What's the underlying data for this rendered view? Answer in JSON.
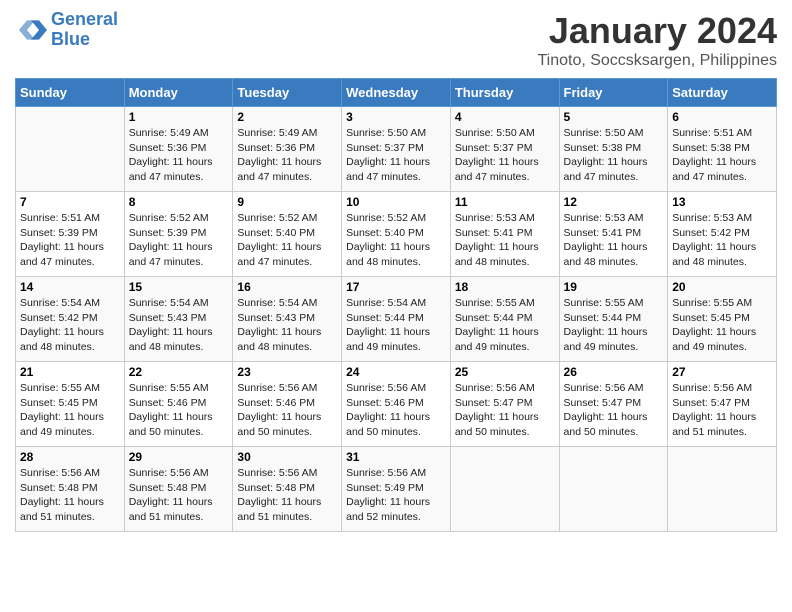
{
  "logo": {
    "line1": "General",
    "line2": "Blue"
  },
  "title": "January 2024",
  "location": "Tinoto, Soccsksargen, Philippines",
  "weekdays": [
    "Sunday",
    "Monday",
    "Tuesday",
    "Wednesday",
    "Thursday",
    "Friday",
    "Saturday"
  ],
  "weeks": [
    [
      {
        "day": "",
        "text": ""
      },
      {
        "day": "1",
        "text": "Sunrise: 5:49 AM\nSunset: 5:36 PM\nDaylight: 11 hours\nand 47 minutes."
      },
      {
        "day": "2",
        "text": "Sunrise: 5:49 AM\nSunset: 5:36 PM\nDaylight: 11 hours\nand 47 minutes."
      },
      {
        "day": "3",
        "text": "Sunrise: 5:50 AM\nSunset: 5:37 PM\nDaylight: 11 hours\nand 47 minutes."
      },
      {
        "day": "4",
        "text": "Sunrise: 5:50 AM\nSunset: 5:37 PM\nDaylight: 11 hours\nand 47 minutes."
      },
      {
        "day": "5",
        "text": "Sunrise: 5:50 AM\nSunset: 5:38 PM\nDaylight: 11 hours\nand 47 minutes."
      },
      {
        "day": "6",
        "text": "Sunrise: 5:51 AM\nSunset: 5:38 PM\nDaylight: 11 hours\nand 47 minutes."
      }
    ],
    [
      {
        "day": "7",
        "text": "Sunrise: 5:51 AM\nSunset: 5:39 PM\nDaylight: 11 hours\nand 47 minutes."
      },
      {
        "day": "8",
        "text": "Sunrise: 5:52 AM\nSunset: 5:39 PM\nDaylight: 11 hours\nand 47 minutes."
      },
      {
        "day": "9",
        "text": "Sunrise: 5:52 AM\nSunset: 5:40 PM\nDaylight: 11 hours\nand 47 minutes."
      },
      {
        "day": "10",
        "text": "Sunrise: 5:52 AM\nSunset: 5:40 PM\nDaylight: 11 hours\nand 48 minutes."
      },
      {
        "day": "11",
        "text": "Sunrise: 5:53 AM\nSunset: 5:41 PM\nDaylight: 11 hours\nand 48 minutes."
      },
      {
        "day": "12",
        "text": "Sunrise: 5:53 AM\nSunset: 5:41 PM\nDaylight: 11 hours\nand 48 minutes."
      },
      {
        "day": "13",
        "text": "Sunrise: 5:53 AM\nSunset: 5:42 PM\nDaylight: 11 hours\nand 48 minutes."
      }
    ],
    [
      {
        "day": "14",
        "text": "Sunrise: 5:54 AM\nSunset: 5:42 PM\nDaylight: 11 hours\nand 48 minutes."
      },
      {
        "day": "15",
        "text": "Sunrise: 5:54 AM\nSunset: 5:43 PM\nDaylight: 11 hours\nand 48 minutes."
      },
      {
        "day": "16",
        "text": "Sunrise: 5:54 AM\nSunset: 5:43 PM\nDaylight: 11 hours\nand 48 minutes."
      },
      {
        "day": "17",
        "text": "Sunrise: 5:54 AM\nSunset: 5:44 PM\nDaylight: 11 hours\nand 49 minutes."
      },
      {
        "day": "18",
        "text": "Sunrise: 5:55 AM\nSunset: 5:44 PM\nDaylight: 11 hours\nand 49 minutes."
      },
      {
        "day": "19",
        "text": "Sunrise: 5:55 AM\nSunset: 5:44 PM\nDaylight: 11 hours\nand 49 minutes."
      },
      {
        "day": "20",
        "text": "Sunrise: 5:55 AM\nSunset: 5:45 PM\nDaylight: 11 hours\nand 49 minutes."
      }
    ],
    [
      {
        "day": "21",
        "text": "Sunrise: 5:55 AM\nSunset: 5:45 PM\nDaylight: 11 hours\nand 49 minutes."
      },
      {
        "day": "22",
        "text": "Sunrise: 5:55 AM\nSunset: 5:46 PM\nDaylight: 11 hours\nand 50 minutes."
      },
      {
        "day": "23",
        "text": "Sunrise: 5:56 AM\nSunset: 5:46 PM\nDaylight: 11 hours\nand 50 minutes."
      },
      {
        "day": "24",
        "text": "Sunrise: 5:56 AM\nSunset: 5:46 PM\nDaylight: 11 hours\nand 50 minutes."
      },
      {
        "day": "25",
        "text": "Sunrise: 5:56 AM\nSunset: 5:47 PM\nDaylight: 11 hours\nand 50 minutes."
      },
      {
        "day": "26",
        "text": "Sunrise: 5:56 AM\nSunset: 5:47 PM\nDaylight: 11 hours\nand 50 minutes."
      },
      {
        "day": "27",
        "text": "Sunrise: 5:56 AM\nSunset: 5:47 PM\nDaylight: 11 hours\nand 51 minutes."
      }
    ],
    [
      {
        "day": "28",
        "text": "Sunrise: 5:56 AM\nSunset: 5:48 PM\nDaylight: 11 hours\nand 51 minutes."
      },
      {
        "day": "29",
        "text": "Sunrise: 5:56 AM\nSunset: 5:48 PM\nDaylight: 11 hours\nand 51 minutes."
      },
      {
        "day": "30",
        "text": "Sunrise: 5:56 AM\nSunset: 5:48 PM\nDaylight: 11 hours\nand 51 minutes."
      },
      {
        "day": "31",
        "text": "Sunrise: 5:56 AM\nSunset: 5:49 PM\nDaylight: 11 hours\nand 52 minutes."
      },
      {
        "day": "",
        "text": ""
      },
      {
        "day": "",
        "text": ""
      },
      {
        "day": "",
        "text": ""
      }
    ]
  ]
}
